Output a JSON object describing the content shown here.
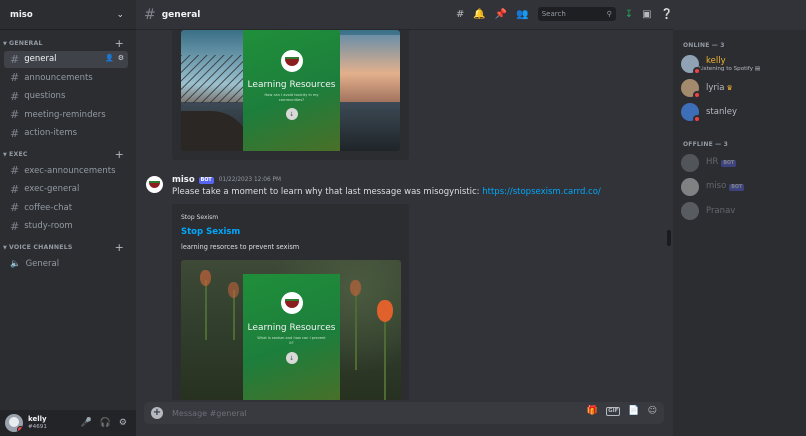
{
  "server": {
    "name": "miso"
  },
  "categories": {
    "general": "GENERAL",
    "exec": "EXEC",
    "voice": "VOICE CHANNELS"
  },
  "channels": {
    "general": [
      "general",
      "announcements",
      "questions",
      "meeting-reminders",
      "action-items"
    ],
    "exec": [
      "exec-announcements",
      "exec-general",
      "coffee-chat",
      "study-room"
    ],
    "voice": [
      "General"
    ]
  },
  "user": {
    "name": "kelly",
    "tag": "#4691"
  },
  "topbar": {
    "channel": "general",
    "search_placeholder": "Search"
  },
  "embed1": {
    "card_title": "Learning Resources",
    "card_sub": "How can I avoid toxicity in my communities?"
  },
  "message": {
    "author": "miso",
    "bot_label": "BOT",
    "time": "01/22/2023 12:06 PM",
    "text": "Please take a moment to learn why that last message was misogynistic: ",
    "link": "https://stopsexism.carrd.co/",
    "embed": {
      "provider": "Stop Sexism",
      "title": "Stop Sexism",
      "description": "learning resorces to prevent sexism",
      "card_title": "Learning Resources",
      "card_sub": "What is sexism and how can I prevent it?"
    }
  },
  "composer": {
    "placeholder": "Message #general",
    "gif": "GIF"
  },
  "members": {
    "online_header": "ONLINE — 3",
    "offline_header": "OFFLINE — 3",
    "online": [
      {
        "name": "kelly",
        "activity": "Listening to Spotify",
        "avatar": "#8fa3b5",
        "status": "#f23f43"
      },
      {
        "name": "lyria",
        "activity": "",
        "avatar": "#a48a6c",
        "status": "#f23f43"
      },
      {
        "name": "stanley",
        "activity": "",
        "avatar": "#3d6fb8",
        "status": "#f23f43"
      }
    ],
    "offline": [
      {
        "name": "HR",
        "bot": "BOT",
        "avatar": "#8a8f96"
      },
      {
        "name": "miso",
        "bot": "BOT",
        "avatar": "#ffffff"
      },
      {
        "name": "Pranav",
        "bot": "",
        "avatar": "#9da2a8"
      }
    ]
  },
  "colors": {
    "accent": "#5865f2",
    "link": "#00a8fc",
    "dnd": "#f23f43",
    "online": "#23a55a",
    "crown": "#f0b232"
  }
}
